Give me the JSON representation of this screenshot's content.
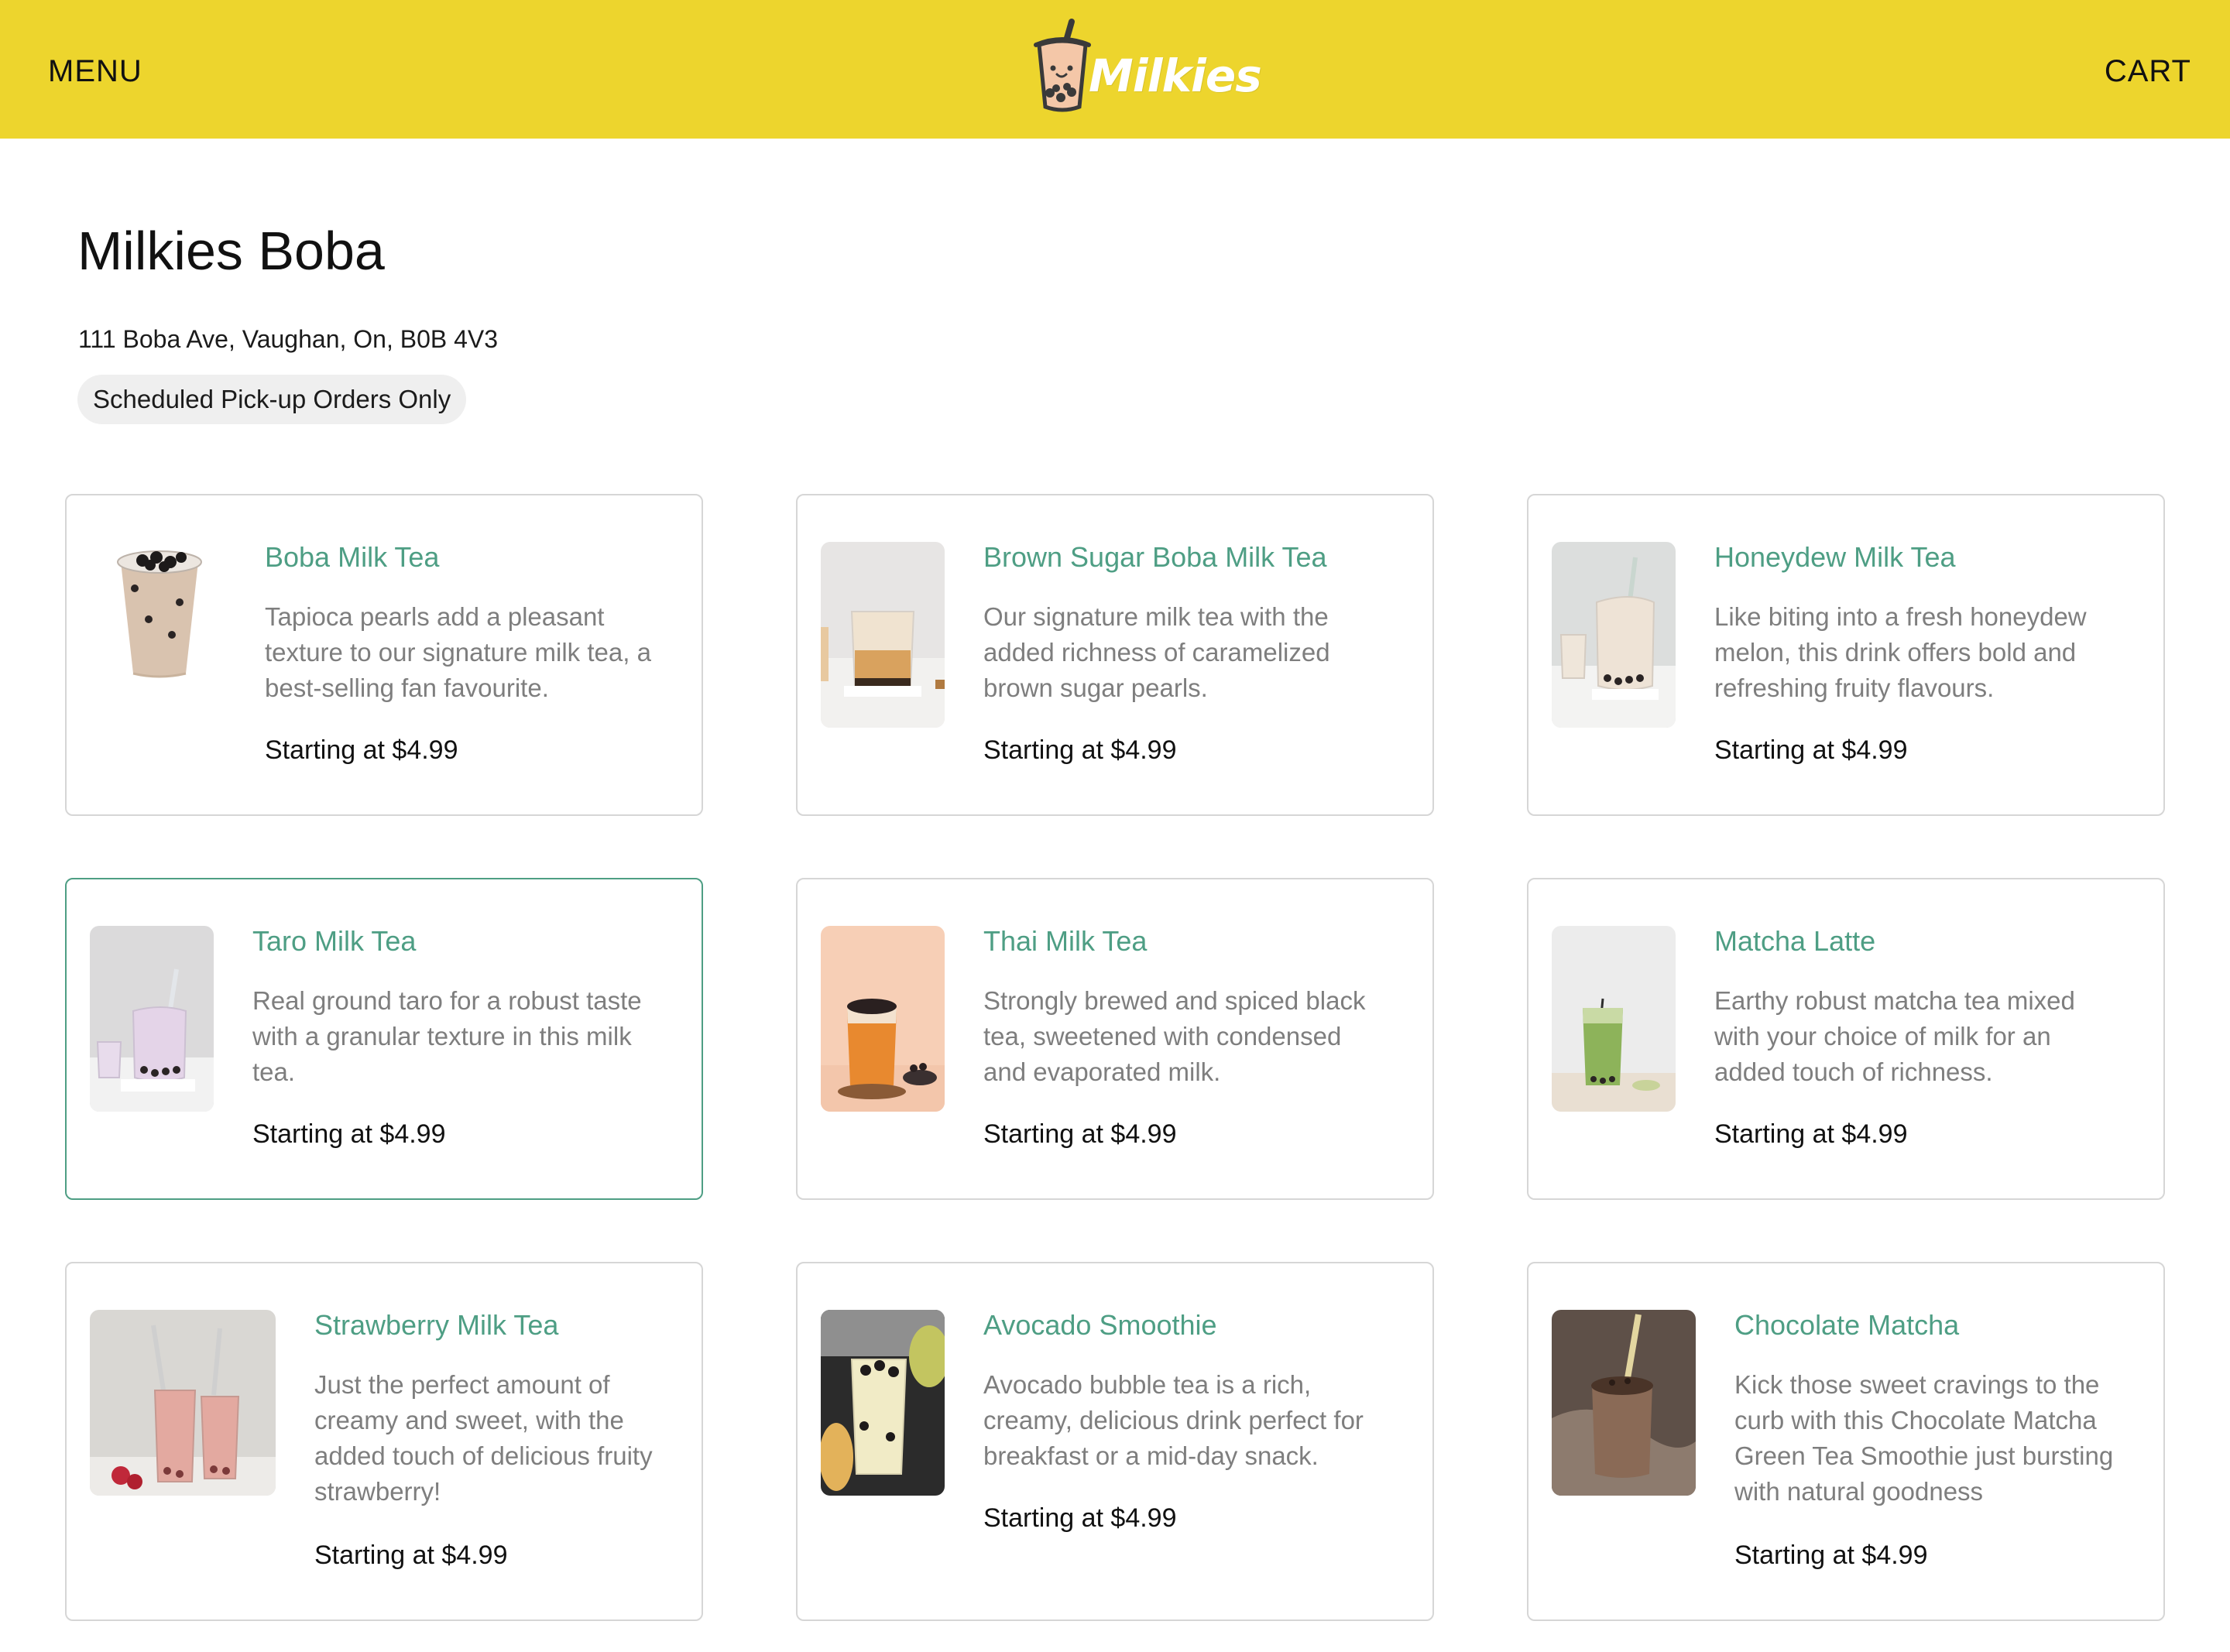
{
  "header": {
    "menu_label": "MENU",
    "cart_label": "CART",
    "logo_text": "Milkies",
    "background_color": "#EDD52D"
  },
  "store": {
    "title": "Milkies Boba",
    "address": "111 Boba Ave, Vaughan, On, B0B 4V3",
    "pickup_badge": "Scheduled Pick-up Orders Only"
  },
  "colors": {
    "accent": "#4E9E84",
    "description_text": "#7E7E7E",
    "card_border": "#D6D6D6",
    "badge_background": "#EFEFEF"
  },
  "menu": {
    "items": [
      {
        "name": "Boba Milk Tea",
        "description": "Tapioca pearls add a pleasant texture to our signature milk tea, a best-selling fan favourite.",
        "price": "Starting at $4.99",
        "image_icon": "boba-milk-tea-cup-icon"
      },
      {
        "name": "Brown Sugar Boba Milk Tea",
        "description": "Our signature milk tea with the added richness of caramelized brown sugar pearls.",
        "price": "Starting at $4.99",
        "image_icon": "brown-sugar-boba-glass-icon"
      },
      {
        "name": "Honeydew Milk Tea",
        "description": "Like biting into a fresh honeydew melon, this drink offers bold and refreshing fruity flavours.",
        "price": "Starting at $4.99",
        "image_icon": "honeydew-milk-tea-jar-icon"
      },
      {
        "name": "Taro Milk Tea",
        "description": "Real ground taro for a robust taste with a granular texture in this milk tea.",
        "price": "Starting at $4.99",
        "image_icon": "taro-milk-tea-jar-icon",
        "selected": true
      },
      {
        "name": "Thai Milk Tea",
        "description": "Strongly brewed and spiced black tea, sweetened with condensed and evaporated milk.",
        "price": "Starting at $4.99",
        "image_icon": "thai-milk-tea-glass-icon"
      },
      {
        "name": "Matcha Latte",
        "description": "Earthy robust matcha tea mixed with your choice of milk for an added touch of richness.",
        "price": "Starting at $4.99",
        "image_icon": "matcha-latte-glass-icon"
      },
      {
        "name": "Strawberry Milk Tea",
        "description": "Just the perfect amount of creamy and sweet, with the added touch of delicious fruity strawberry!",
        "price": "Starting at $4.99",
        "image_icon": "strawberry-milk-tea-glasses-icon"
      },
      {
        "name": "Avocado Smoothie",
        "description": "Avocado bubble tea is a rich, creamy, delicious drink perfect for breakfast or a mid-day snack.",
        "price": "Starting at $4.99",
        "image_icon": "avocado-smoothie-glass-icon"
      },
      {
        "name": "Chocolate Matcha",
        "description": "Kick those sweet cravings to the curb with this Chocolate Matcha Green Tea Smoothie just bursting with natural goodness",
        "price": "Starting at $4.99",
        "image_icon": "chocolate-matcha-jar-icon"
      }
    ]
  }
}
